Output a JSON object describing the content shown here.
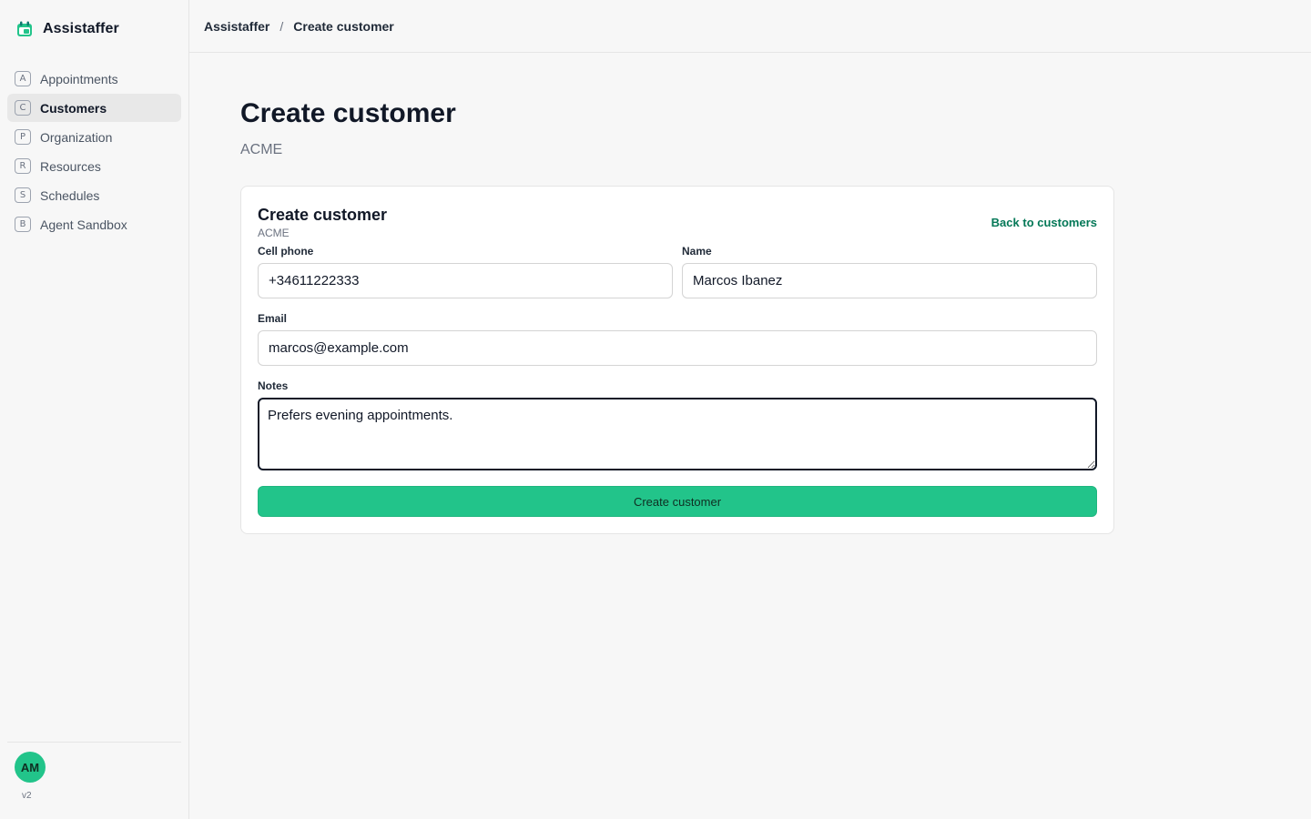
{
  "app": {
    "name": "Assistaffer",
    "accent": "#22c48a",
    "link_color": "#047857"
  },
  "sidebar": {
    "items": [
      {
        "key": "A",
        "label": "Appointments",
        "active": false
      },
      {
        "key": "C",
        "label": "Customers",
        "active": true
      },
      {
        "key": "P",
        "label": "Organization",
        "active": false
      },
      {
        "key": "R",
        "label": "Resources",
        "active": false
      },
      {
        "key": "S",
        "label": "Schedules",
        "active": false
      },
      {
        "key": "B",
        "label": "Agent Sandbox",
        "active": false
      }
    ],
    "user_initials": "AM",
    "version": "v2"
  },
  "breadcrumb": {
    "root": "Assistaffer",
    "separator": "/",
    "current": "Create customer"
  },
  "page": {
    "title": "Create customer",
    "subtitle": "ACME"
  },
  "form": {
    "title": "Create customer",
    "subtitle": "ACME",
    "back_label": "Back to customers",
    "cell_phone": {
      "label": "Cell phone",
      "value": "+34611222333"
    },
    "name": {
      "label": "Name",
      "value": "Marcos Ibanez"
    },
    "email": {
      "label": "Email",
      "value": "marcos@example.com"
    },
    "notes": {
      "label": "Notes",
      "value": "Prefers evening appointments."
    },
    "submit_label": "Create customer"
  }
}
